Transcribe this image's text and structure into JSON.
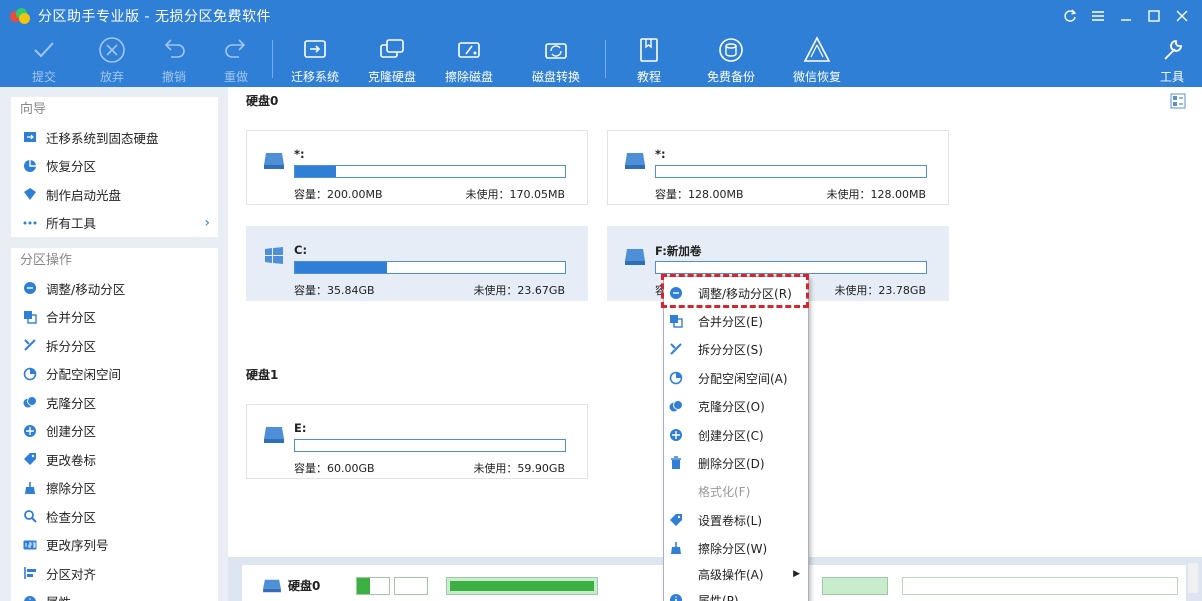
{
  "window": {
    "title": "分区助手专业版 - 无损分区免费软件"
  },
  "toolbar": {
    "items": [
      {
        "label": "提交",
        "icon": "check-icon"
      },
      {
        "label": "放弃",
        "icon": "close-circle-icon"
      },
      {
        "label": "撤销",
        "icon": "undo-icon"
      },
      {
        "label": "重做",
        "icon": "redo-icon"
      },
      {
        "label": "迁移系统",
        "icon": "migrate-os-icon"
      },
      {
        "label": "克隆硬盘",
        "icon": "clone-disk-icon"
      },
      {
        "label": "擦除磁盘",
        "icon": "wipe-disk-icon"
      },
      {
        "label": "磁盘转换",
        "icon": "convert-disk-icon"
      },
      {
        "label": "教程",
        "icon": "tutorial-icon"
      },
      {
        "label": "免费备份",
        "icon": "backup-icon"
      },
      {
        "label": "微信恢复",
        "icon": "wechat-recover-icon"
      },
      {
        "label": "工具",
        "icon": "tools-icon"
      }
    ]
  },
  "sidebar": {
    "guide": {
      "title": "向导",
      "items": [
        {
          "label": "迁移系统到固态硬盘"
        },
        {
          "label": "恢复分区"
        },
        {
          "label": "制作启动光盘"
        },
        {
          "label": "所有工具"
        }
      ]
    },
    "ops": {
      "title": "分区操作",
      "items": [
        {
          "label": "调整/移动分区"
        },
        {
          "label": "合并分区"
        },
        {
          "label": "拆分分区"
        },
        {
          "label": "分配空闲空间"
        },
        {
          "label": "克隆分区"
        },
        {
          "label": "创建分区"
        },
        {
          "label": "更改卷标"
        },
        {
          "label": "擦除分区"
        },
        {
          "label": "检查分区"
        },
        {
          "label": "更改序列号"
        },
        {
          "label": "分区对齐"
        },
        {
          "label": "属性"
        }
      ]
    }
  },
  "main": {
    "disk0_label": "硬盘0",
    "disk1_label": "硬盘1",
    "partitions": [
      {
        "name": "*:",
        "capacity": "容量：200.00MB",
        "free": "未使用：170.05MB",
        "used_fraction": 0.15
      },
      {
        "name": "*:",
        "capacity": "容量：128.00MB",
        "free": "未使用：128.00MB",
        "used_fraction": 0.0
      },
      {
        "name": "C:",
        "capacity": "容量：35.84GB",
        "free": "未使用：23.67GB",
        "used_fraction": 0.34
      },
      {
        "name": "F:新加卷",
        "capacity": "容",
        "free": "未使用：23.78GB",
        "used_fraction": 0.0
      },
      {
        "name": "E:",
        "capacity": "容量：60.00GB",
        "free": "未使用：59.90GB",
        "used_fraction": 0.0
      }
    ]
  },
  "bottom": {
    "disk_label": "硬盘0"
  },
  "context_menu": {
    "items": [
      {
        "label": "调整/移动分区(R)"
      },
      {
        "label": "合并分区(E)"
      },
      {
        "label": "拆分分区(S)"
      },
      {
        "label": "分配空闲空间(A)"
      },
      {
        "label": "克隆分区(O)"
      },
      {
        "label": "创建分区(C)"
      },
      {
        "label": "删除分区(D)"
      },
      {
        "label": "格式化(F)"
      },
      {
        "label": "设置卷标(L)"
      },
      {
        "label": "擦除分区(W)"
      },
      {
        "label": "高级操作(A)"
      },
      {
        "label": "属性(P)"
      }
    ]
  },
  "colors": {
    "accent": "#2f7fd6",
    "highlight": "#d8242a"
  }
}
